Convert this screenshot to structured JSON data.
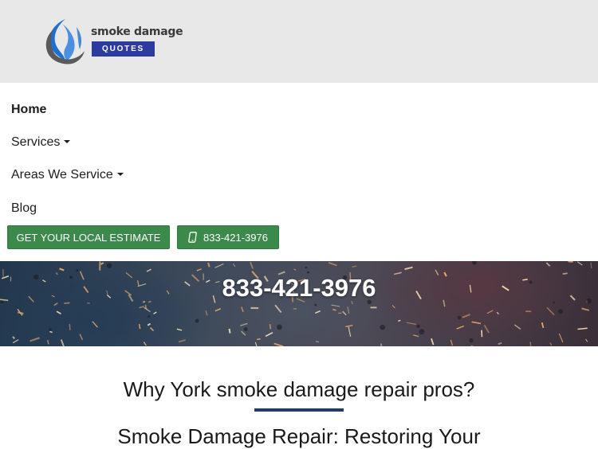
{
  "logo": {
    "name": "smoke damage",
    "badge": "QUOTES",
    "mark_colors": [
      "#1e6fd0",
      "#5a5a5a"
    ]
  },
  "nav": {
    "items": [
      {
        "label": "Home",
        "active": true,
        "dropdown": false
      },
      {
        "label": "Services",
        "active": false,
        "dropdown": true
      },
      {
        "label": "Areas We Service",
        "active": false,
        "dropdown": true
      },
      {
        "label": "Blog",
        "active": false,
        "dropdown": false
      }
    ]
  },
  "cta": {
    "estimate_label": "GET YOUR LOCAL ESTIMATE",
    "phone_label": "833-421-3976",
    "phone_icon": "phone-icon",
    "color": "#3b8a4b"
  },
  "hero": {
    "phone": "833-421-3976"
  },
  "content": {
    "heading": "Why York smoke damage repair pros?",
    "subheading": "Smoke Damage Repair: Restoring Your",
    "divider_color": "#1f3c6e"
  }
}
